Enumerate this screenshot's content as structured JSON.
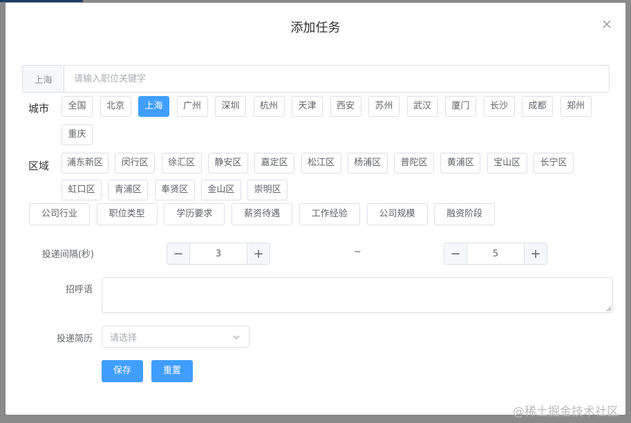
{
  "dialog": {
    "title": "添加任务"
  },
  "search": {
    "prefix": "上海",
    "placeholder": "请输入职位关键字",
    "value": ""
  },
  "city": {
    "label": "城市",
    "items": [
      "全国",
      "北京",
      "上海",
      "广州",
      "深圳",
      "杭州",
      "天津",
      "西安",
      "苏州",
      "武汉",
      "厦门",
      "长沙",
      "成都",
      "郑州",
      "重庆"
    ],
    "selected": "上海"
  },
  "district": {
    "label": "区域",
    "items": [
      "浦东新区",
      "闵行区",
      "徐汇区",
      "静安区",
      "嘉定区",
      "松江区",
      "杨浦区",
      "普陀区",
      "黄浦区",
      "宝山区",
      "长宁区",
      "虹口区",
      "青浦区",
      "奉贤区",
      "金山区",
      "崇明区"
    ]
  },
  "filters": [
    "公司行业",
    "职位类型",
    "学历要求",
    "薪资待遇",
    "工作经验",
    "公司规模",
    "融资阶段"
  ],
  "interval": {
    "label": "投递间隔(秒)",
    "min": "3",
    "max": "5",
    "separator": "~"
  },
  "greeting": {
    "label": "招呼语",
    "value": ""
  },
  "resume": {
    "label": "投递简历",
    "placeholder": "请选择"
  },
  "actions": {
    "save": "保存",
    "reset": "重置"
  },
  "watermark": "@稀土掘金技术社区",
  "colors": {
    "primary": "#409eff",
    "border": "#dcdfe6"
  }
}
